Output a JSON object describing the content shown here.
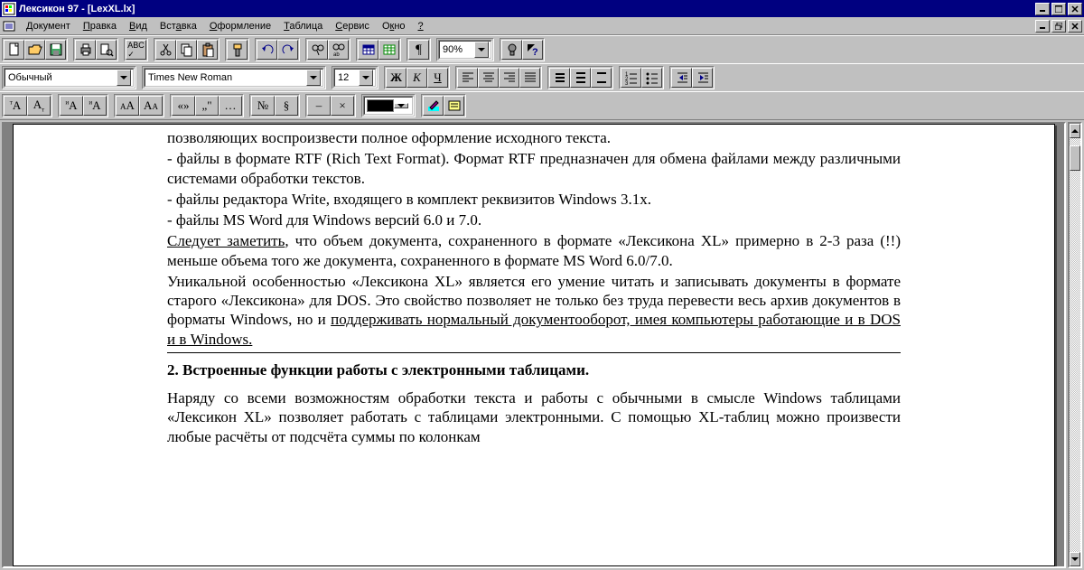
{
  "window": {
    "title": "Лексикон 97 - [LexXL.lx]"
  },
  "menu": {
    "items": [
      "Документ",
      "Правка",
      "Вид",
      "Вставка",
      "Оформление",
      "Таблица",
      "Сервис",
      "Окно",
      "?"
    ]
  },
  "toolbar1": {
    "zoom": "90%"
  },
  "toolbar2": {
    "style": "Обычный",
    "font": "Times New Roman",
    "size": "12",
    "bold": "Ж",
    "italic": "К",
    "underline": "Ч"
  },
  "toolbar3": {
    "sym_num": "№",
    "sym_sect": "§",
    "sym_minus": "–",
    "sym_mult": "×",
    "quote_open": "«»",
    "quote_low": "„\"",
    "ellipsis": "…"
  },
  "document": {
    "p0": "позволяющих воспроизвести полное оформление исходного текста.",
    "p1": "- файлы в формате RTF (Rich Text Format). Формат RTF предназначен для обмена файлами между различными системами обработки текстов.",
    "p2": "- файлы редактора Write, входящего в комплект реквизитов Windows 3.1x.",
    "p3": "- файлы MS Word для Windows версий 6.0 и 7.0.",
    "p4a": "Следует заметить",
    "p4b": ", что объем документа, сохраненного в формате «Лексикона XL» примерно в 2-3 раза (!!) меньше объема того же документа, сохраненного в формате MS Word 6.0/7.0.",
    "p5a": "Уникальной особенностью «Лексикона XL» является его умение читать и записывать документы в формате старого «Лексикона» для DOS. Это свойство позволяет не только без труда перевести весь архив документов в форматы Windows, но и ",
    "p5b": "поддерживать нормальный документооборот, имея компьютеры работающие и в DOS и в Windows.",
    "h2": "2. Встроенные функции работы с электронными таблицами.",
    "p6": "Наряду со всеми возможностям обработки текста и работы с обычными в смысле Windows таблицами «Лексикон XL» позволяет работать с таблицами электронными. С помощью XL-таблиц можно произвести любые расчёты от подсчёта суммы по колонкам"
  }
}
